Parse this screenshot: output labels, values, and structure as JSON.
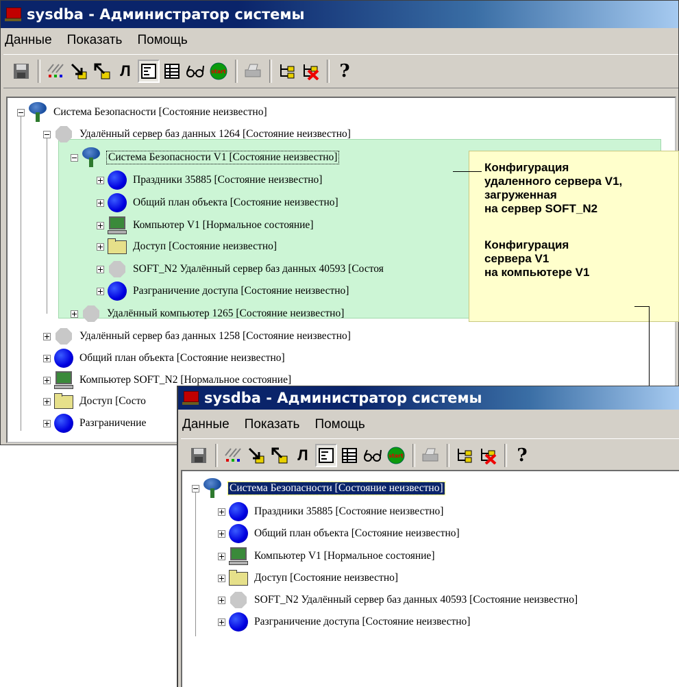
{
  "window_top": {
    "title": "sysdba - Администратор системы",
    "menu": [
      "Данные",
      "Показать",
      "Помощь"
    ],
    "tree": [
      {
        "label": "Система Безопасности [Состояние неизвестно]",
        "icon": "tree-icon",
        "expanded": true
      },
      {
        "label": "Удалённый сервер баз данных 1264 [Состояние неизвестно]",
        "icon": "server-icon",
        "expanded": true
      },
      {
        "label": "Система Безопасности V1 [Состояние неизвестно]",
        "icon": "tree-icon",
        "expanded": true,
        "focused": true
      },
      {
        "label": "Праздники 35885 [Состояние неизвестно]",
        "icon": "blue-circle-icon"
      },
      {
        "label": "Общий план объекта [Состояние неизвестно]",
        "icon": "blue-circle-icon"
      },
      {
        "label": "Компьютер V1 [Нормальное состояние]",
        "icon": "computer-icon"
      },
      {
        "label": "Доступ [Состояние неизвестно]",
        "icon": "folder-icon"
      },
      {
        "label": "SOFT_N2 Удалённый сервер баз данных 40593 [Состоя",
        "icon": "server-icon"
      },
      {
        "label": "Разграничение доступа [Состояние неизвестно]",
        "icon": "blue-circle-icon"
      },
      {
        "label": "Удалённый компьютер 1265 [Состояние неизвестно]",
        "icon": "server-icon"
      },
      {
        "label": "Удалённый сервер баз данных 1258 [Состояние неизвестно]",
        "icon": "server-icon"
      },
      {
        "label": "Общий план объекта [Состояние неизвестно]",
        "icon": "blue-circle-icon"
      },
      {
        "label": "Компьютер SOFT_N2 [Нормальное состояние]",
        "icon": "computer-icon"
      },
      {
        "label": "Доступ [Состо",
        "icon": "folder-icon"
      },
      {
        "label": "Разграничение",
        "icon": "blue-circle-icon"
      }
    ]
  },
  "window_bottom": {
    "title": "sysdba - Администратор системы",
    "menu": [
      "Данные",
      "Показать",
      "Помощь"
    ],
    "tree": [
      {
        "label": "Система Безопасности [Состояние неизвестно]",
        "icon": "tree-icon",
        "selected": true
      },
      {
        "label": "Праздники 35885 [Состояние неизвестно]",
        "icon": "blue-circle-icon"
      },
      {
        "label": "Общий план объекта [Состояние неизвестно]",
        "icon": "blue-circle-icon"
      },
      {
        "label": "Компьютер V1 [Нормальное состояние]",
        "icon": "computer-icon"
      },
      {
        "label": "Доступ [Состояние неизвестно]",
        "icon": "folder-icon"
      },
      {
        "label": "SOFT_N2 Удалённый сервер баз данных 40593 [Состояние неизвестно]",
        "icon": "server-icon"
      },
      {
        "label": "Разграничение доступа [Состояние неизвестно]",
        "icon": "blue-circle-icon"
      }
    ]
  },
  "callout": {
    "text1": [
      "Конфигурация",
      "удаленного сервера V1,",
      "загруженная",
      "на сервер SOFT_N2"
    ],
    "text2": [
      "Конфигурация",
      "сервера V1",
      "на компьютере V1"
    ]
  },
  "toolbar_icons": [
    "save-icon",
    "hatch-icon",
    "arrow-down-right-icon",
    "arrow-up-left-icon",
    "pi-icon",
    "form-icon",
    "table-icon",
    "glasses-icon",
    "start-icon",
    "print-icon",
    "network-add-icon",
    "network-delete-icon",
    "help-icon"
  ],
  "toolbar_text": {
    "pi": "Л",
    "start": "start",
    "help": "?"
  },
  "colors": {
    "title_bar": "#0a246a",
    "highlight": "#ccf5d5",
    "callout": "#ffffcc",
    "selection": "#0a246a"
  }
}
